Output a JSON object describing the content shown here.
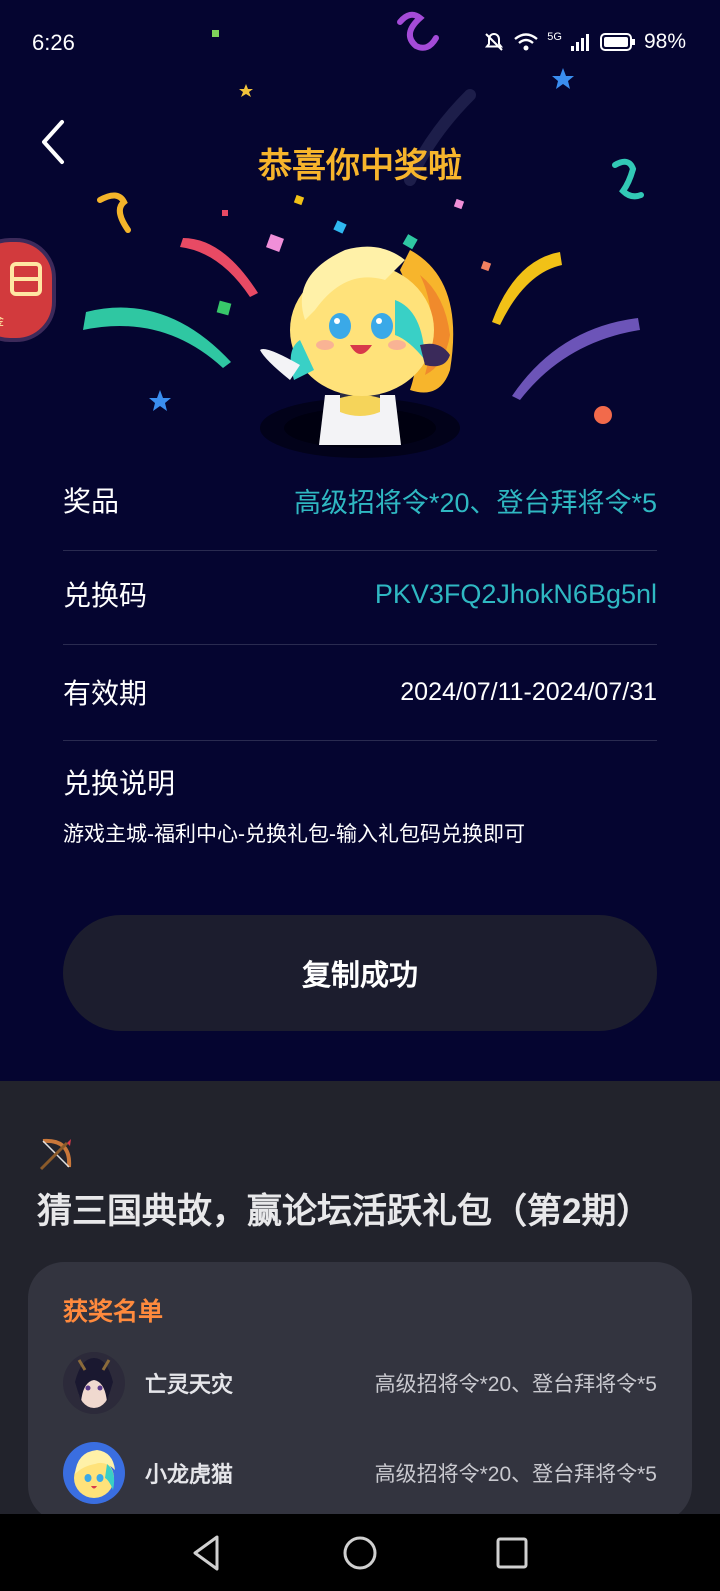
{
  "status_bar": {
    "time": "6:26",
    "network": "5G",
    "battery": "98%"
  },
  "dialog": {
    "title": "恭喜你中奖啦",
    "prize_label": "奖品",
    "prize_value": "高级招将令*20、登台拜将令*5",
    "code_label": "兑换码",
    "code_value": "PKV3FQ2JhokN6Bg5nl",
    "validity_label": "有效期",
    "validity_value": "2024/07/11-2024/07/31",
    "instructions_label": "兑换说明",
    "instructions_text": "游戏主城-福利中心-兑换礼包-输入礼包码兑换即可",
    "copy_button": "复制成功",
    "side_badge_text": "现金"
  },
  "post": {
    "title": "猜三国典故，赢论坛活跃礼包（第2期）"
  },
  "winners": {
    "title": "获奖名单",
    "items": [
      {
        "name": "亡灵天灾",
        "prize": "高级招将令*20、登台拜将令*5"
      },
      {
        "name": "小龙虎猫",
        "prize": "高级招将令*20、登台拜将令*5"
      }
    ]
  },
  "colors": {
    "background": "#050530",
    "title_gold": "#f7b52c",
    "value_teal": "#2fb8c2",
    "winners_orange": "#ff8a3d"
  }
}
